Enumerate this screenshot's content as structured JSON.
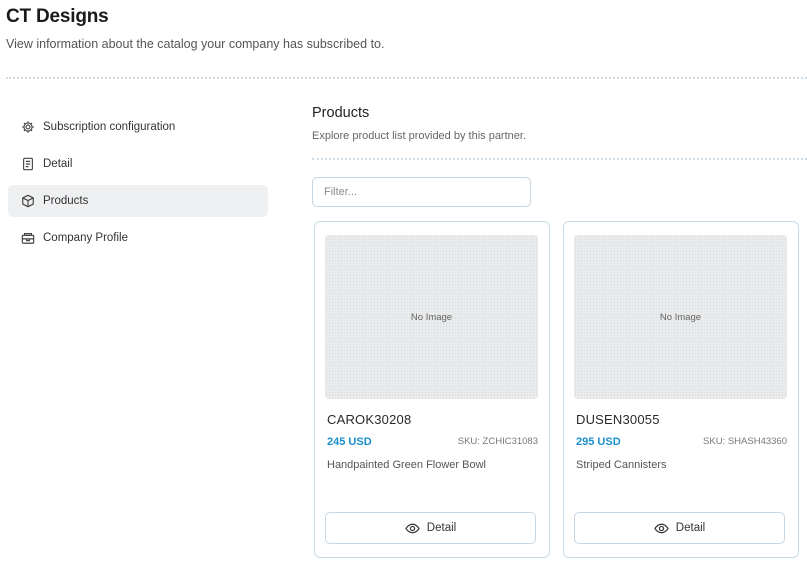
{
  "header": {
    "title": "CT Designs",
    "subtitle": "View information about the catalog your company has subscribed to."
  },
  "sidebar": {
    "items": [
      {
        "label": "Subscription configuration",
        "icon": "gear-icon",
        "active": false
      },
      {
        "label": "Detail",
        "icon": "document-icon",
        "active": false
      },
      {
        "label": "Products",
        "icon": "box-icon",
        "active": true
      },
      {
        "label": "Company Profile",
        "icon": "building-icon",
        "active": false
      }
    ]
  },
  "main": {
    "title": "Products",
    "subtitle": "Explore product list provided by this partner.",
    "filter": {
      "placeholder": "Filter...",
      "value": ""
    },
    "products": [
      {
        "image_text": "No Image",
        "name": "CAROK30208",
        "price": "245 USD",
        "sku": "SKU: ZCHIC31083",
        "description": "Handpainted Green Flower Bowl",
        "button_label": "Detail"
      },
      {
        "image_text": "No Image",
        "name": "DUSEN30055",
        "price": "295 USD",
        "sku": "SKU: SHASH43360",
        "description": "Striped Cannisters",
        "button_label": "Detail"
      }
    ]
  },
  "colors": {
    "accent": "#1a8fd0",
    "divider": "#cfdce6",
    "active_bg": "#eef0f2"
  }
}
